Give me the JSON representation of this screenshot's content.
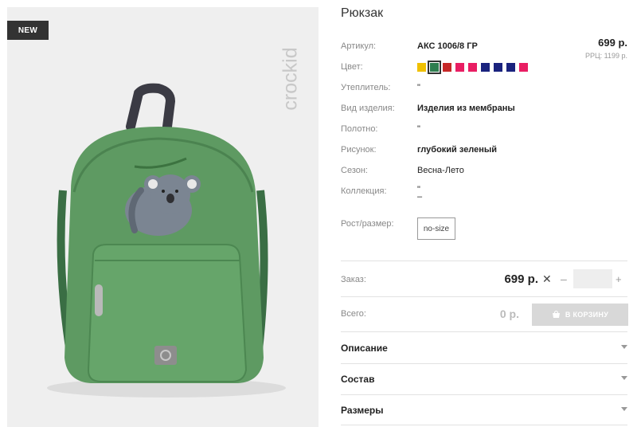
{
  "photo": {
    "badge": "NEW",
    "brand": "crockid"
  },
  "product": {
    "title": "Рюкзак",
    "price": "699 р.",
    "rrp": "РРЦ: 1199 р."
  },
  "specs": [
    {
      "label": "Артикул:",
      "value": "АКС 1006/8 ГР"
    },
    {
      "label": "Цвет:"
    },
    {
      "label": "Утеплитель:",
      "value": "\""
    },
    {
      "label": "Вид изделия:",
      "value": "Изделия из мембраны"
    },
    {
      "label": "Полотно:",
      "value": "\""
    },
    {
      "label": "Рисунок:",
      "value": "глубокий зеленый"
    },
    {
      "label": "Сезон:",
      "value": "Весна-Лето"
    },
    {
      "label": "Коллекция:",
      "value": "\"",
      "value2": "–"
    },
    {
      "label": "Рост/размер:",
      "value": "no-size"
    }
  ],
  "colors": [
    "#f0c000",
    "#2e7d4f",
    "#c62828",
    "#e91e63",
    "#e91e63",
    "#1a237e",
    "#1a237e",
    "#1a237e",
    "#e91e63"
  ],
  "order": {
    "label": "Заказ:",
    "price": "699 р.",
    "multiply": "✕",
    "minus": "–",
    "plus": "+",
    "quantity": ""
  },
  "total": {
    "label": "Всего:",
    "value": "0 р.",
    "cart_label": "В КОРЗИНУ"
  },
  "accordions": [
    "Описание",
    "Состав",
    "Размеры"
  ]
}
